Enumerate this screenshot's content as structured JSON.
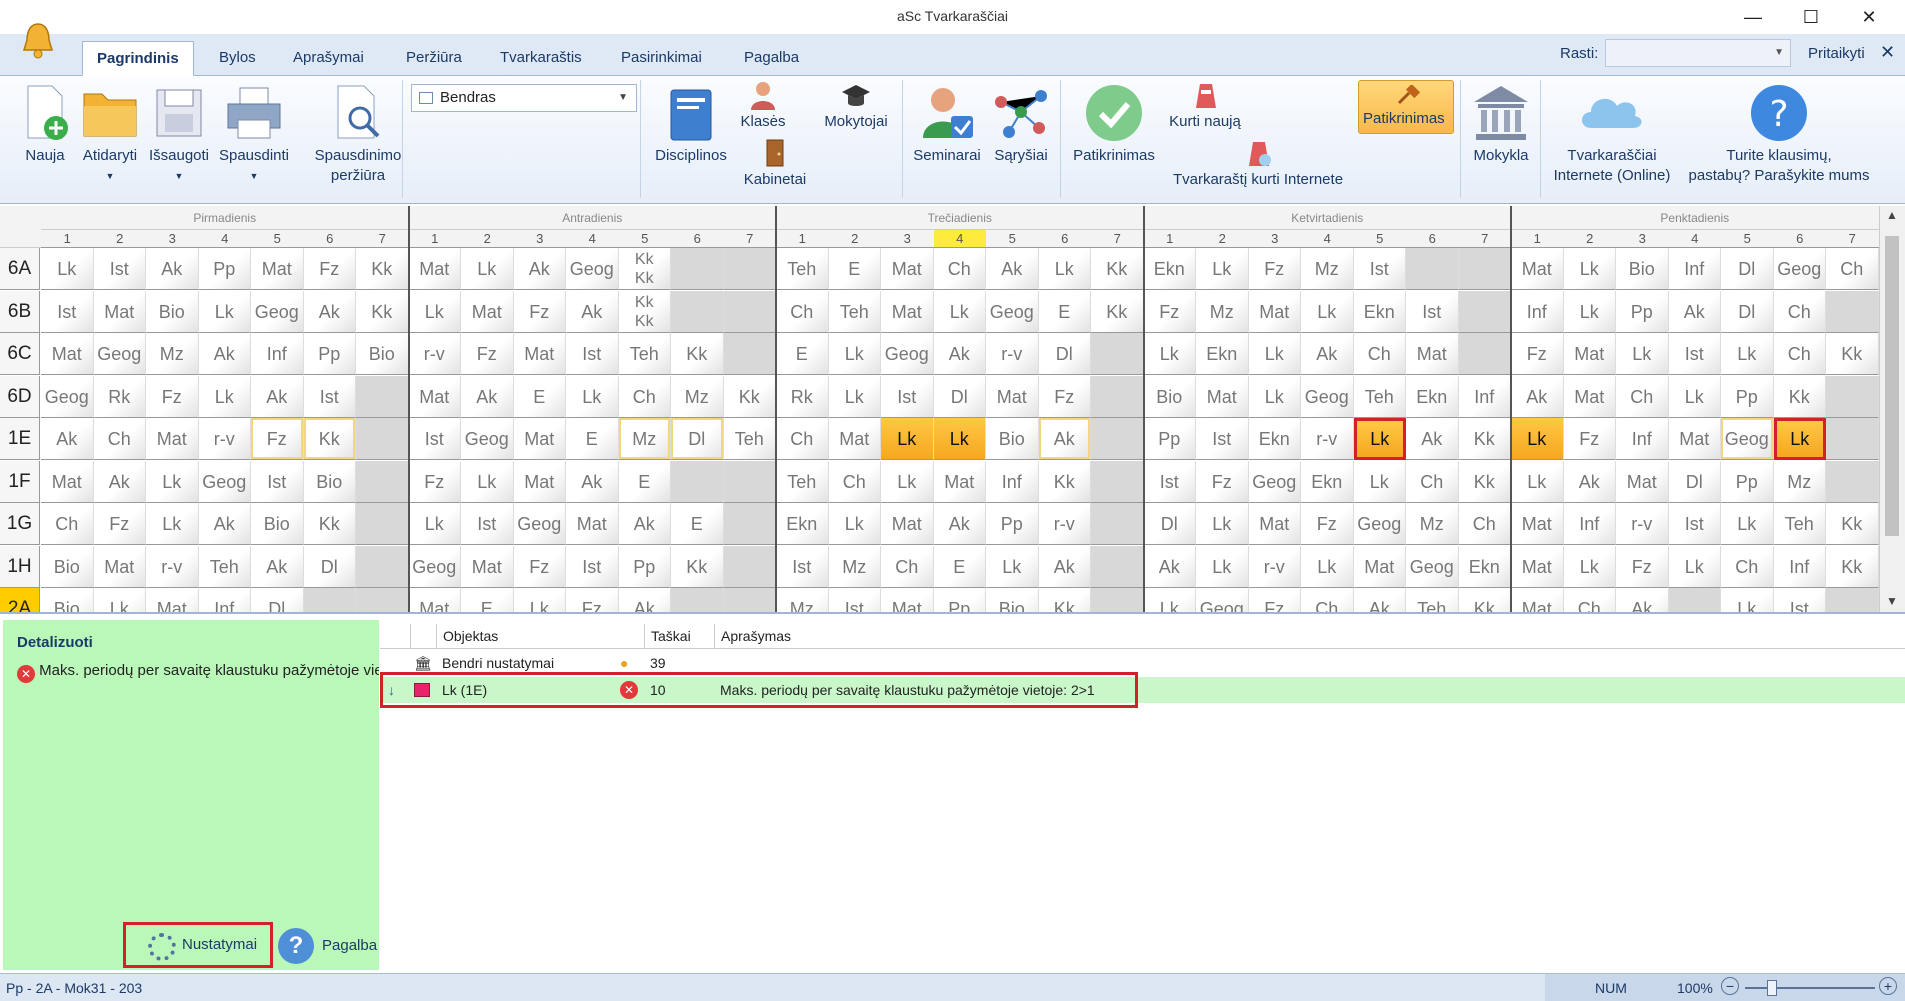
{
  "window": {
    "title": "aSc Tvarkaraščiai",
    "minimize": "—",
    "maximize": "☐",
    "close": "✕"
  },
  "tabs": [
    "Pagrindinis",
    "Bylos",
    "Aprašymai",
    "Peržiūra",
    "Tvarkaraštis",
    "Pasirinkimai",
    "Pagalba"
  ],
  "search": {
    "label": "Rasti:",
    "value": "",
    "right_label": "Pritaikyti",
    "close": "✕"
  },
  "ribbon": {
    "nauja": "Nauja",
    "atidaryti": "Atidaryti",
    "issaugoti": "Išsaugoti",
    "spausdinti": "Spausdinti",
    "spaudinimo_perziura_1": "Spausdinimo",
    "spaudinimo_perziura_2": "peržiūra",
    "view_combo": "Bendras",
    "disciplinos": "Disciplinos",
    "klases": "Klasės",
    "kabinetai": "Kabinetai",
    "mokytojai": "Mokytojai",
    "seminarai": "Seminarai",
    "sarysiai": "Sąryšiai",
    "patikrinimas_big": "Patikrinimas",
    "kurti_nauja": "Kurti naują",
    "kurti_internete": "Tvarkaraštį kurti Internete",
    "patikrinimas_active": "Patikrinimas",
    "mokykla": "Mokykla",
    "online_1": "Tvarkaraščiai",
    "online_2": "Internete (Online)",
    "klausimai_1": "Turite klausimų,",
    "klausimai_2": "pastabų? Parašykite mums"
  },
  "grid": {
    "days": [
      "Pirmadienis",
      "Antradienis",
      "Trečiadienis",
      "Ketvirtadienis",
      "Penktadienis"
    ],
    "periods": [
      "1",
      "2",
      "3",
      "4",
      "5",
      "6",
      "7"
    ],
    "highlighted_period": {
      "day": 2,
      "period": 4
    },
    "rows": [
      {
        "name": "6A",
        "cells": [
          [
            "Lk",
            "Ist",
            "Ak",
            "Pp",
            "Mat",
            "Fz",
            "Kk"
          ],
          [
            "Mat",
            "Lk",
            "Ak",
            "Geog",
            "Kk/Kk",
            "",
            ""
          ],
          [
            "Teh",
            "E",
            "Mat",
            "Ch",
            "Ak",
            "Lk",
            "Kk"
          ],
          [
            "Ekn",
            "Lk",
            "Fz",
            "Mz",
            "Ist",
            "",
            ""
          ],
          [
            "Mat",
            "Lk",
            "Bio",
            "Inf",
            "Dl",
            "Geog",
            "Ch"
          ]
        ]
      },
      {
        "name": "6B",
        "cells": [
          [
            "Ist",
            "Mat",
            "Bio",
            "Lk",
            "Geog",
            "Ak",
            "Kk"
          ],
          [
            "Lk",
            "Mat",
            "Fz",
            "Ak",
            "Kk/Kk",
            "",
            ""
          ],
          [
            "Ch",
            "Teh",
            "Mat",
            "Lk",
            "Geog",
            "E",
            "Kk"
          ],
          [
            "Fz",
            "Mz",
            "Mat",
            "Lk",
            "Ekn",
            "Ist",
            ""
          ],
          [
            "Inf",
            "Lk",
            "Pp",
            "Ak",
            "Dl",
            "Ch",
            ""
          ]
        ]
      },
      {
        "name": "6C",
        "cells": [
          [
            "Mat",
            "Geog",
            "Mz",
            "Ak",
            "Inf",
            "Pp",
            "Bio"
          ],
          [
            "r-v",
            "Fz",
            "Mat",
            "Ist",
            "Teh",
            "Kk",
            ""
          ],
          [
            "E",
            "Lk",
            "Geog",
            "Ak",
            "r-v",
            "Dl",
            ""
          ],
          [
            "Lk",
            "Ekn",
            "Lk",
            "Ak",
            "Ch",
            "Mat",
            ""
          ],
          [
            "Fz",
            "Mat",
            "Lk",
            "Ist",
            "Lk",
            "Ch",
            "Kk"
          ]
        ]
      },
      {
        "name": "6D",
        "cells": [
          [
            "Geog",
            "Rk",
            "Fz",
            "Lk",
            "Ak",
            "Ist",
            ""
          ],
          [
            "Mat",
            "Ak",
            "E",
            "Lk",
            "Ch",
            "Mz",
            "Kk"
          ],
          [
            "Rk",
            "Lk",
            "Ist",
            "Dl",
            "Mat",
            "Fz",
            ""
          ],
          [
            "Bio",
            "Mat",
            "Lk",
            "Geog",
            "Teh",
            "Ekn",
            "Inf"
          ],
          [
            "Ak",
            "Mat",
            "Ch",
            "Lk",
            "Pp",
            "Kk",
            ""
          ]
        ]
      },
      {
        "name": "1E",
        "cells": [
          [
            "Ak",
            "Ch",
            "Mat",
            "r-v",
            "Fz",
            "Kk",
            ""
          ],
          [
            "Ist",
            "Geog",
            "Mat",
            "E",
            "Mz",
            "Dl",
            "Teh"
          ],
          [
            "Ch",
            "Mat",
            "Lk",
            "Lk",
            "Bio",
            "Ak",
            ""
          ],
          [
            "Pp",
            "Ist",
            "Ekn",
            "r-v",
            "Lk",
            "Ak",
            "Kk"
          ],
          [
            "Lk",
            "Fz",
            "Inf",
            "Mat",
            "Geog",
            "Lk",
            ""
          ]
        ]
      },
      {
        "name": "1F",
        "cells": [
          [
            "Mat",
            "Ak",
            "Lk",
            "Geog",
            "Ist",
            "Bio",
            ""
          ],
          [
            "Fz",
            "Lk",
            "Mat",
            "Ak",
            "E",
            "",
            ""
          ],
          [
            "Teh",
            "Ch",
            "Lk",
            "Mat",
            "Inf",
            "Kk",
            ""
          ],
          [
            "Ist",
            "Fz",
            "Geog",
            "Ekn",
            "Lk",
            "Ch",
            "Kk"
          ],
          [
            "Lk",
            "Ak",
            "Mat",
            "Dl",
            "Pp",
            "Mz",
            ""
          ]
        ]
      },
      {
        "name": "1G",
        "cells": [
          [
            "Ch",
            "Fz",
            "Lk",
            "Ak",
            "Bio",
            "Kk",
            ""
          ],
          [
            "Lk",
            "Ist",
            "Geog",
            "Mat",
            "Ak",
            "E",
            ""
          ],
          [
            "Ekn",
            "Lk",
            "Mat",
            "Ak",
            "Pp",
            "r-v",
            ""
          ],
          [
            "Dl",
            "Lk",
            "Mat",
            "Fz",
            "Geog",
            "Mz",
            "Ch"
          ],
          [
            "Mat",
            "Inf",
            "r-v",
            "Ist",
            "Lk",
            "Teh",
            "Kk"
          ]
        ]
      },
      {
        "name": "1H",
        "cells": [
          [
            "Bio",
            "Mat",
            "r-v",
            "Teh",
            "Ak",
            "Dl",
            ""
          ],
          [
            "Geog",
            "Mat",
            "Fz",
            "Ist",
            "Pp",
            "Kk",
            ""
          ],
          [
            "Ist",
            "Mz",
            "Ch",
            "E",
            "Lk",
            "Ak",
            ""
          ],
          [
            "Ak",
            "Lk",
            "r-v",
            "Lk",
            "Mat",
            "Geog",
            "Ekn"
          ],
          [
            "Mat",
            "Lk",
            "Fz",
            "Lk",
            "Ch",
            "Inf",
            "Kk"
          ]
        ]
      },
      {
        "name": "2A",
        "cells": [
          [
            "Bio",
            "Lk",
            "Mat",
            "Inf",
            "Dl",
            "",
            ""
          ],
          [
            "Mat",
            "E",
            "Lk",
            "Fz",
            "Ak",
            "",
            ""
          ],
          [
            "Mz",
            "Ist",
            "Mat",
            "Pp",
            "Bio",
            "Kk",
            ""
          ],
          [
            "Lk",
            "Geog",
            "Fz",
            "Ch",
            "Ak",
            "Teh",
            "Kk"
          ],
          [
            "Mat",
            "Ch",
            "Ak",
            "",
            "Lk",
            "Ist",
            ""
          ]
        ]
      }
    ]
  },
  "details": {
    "header": "Detalizuoti",
    "message": "Maks. periodų per savaitę klaustuku pažymėtoje vietoje: 2>1",
    "settings_button": "Nustatymai",
    "help_button": "Pagalba"
  },
  "table": {
    "columns": [
      "Objektas",
      "Taškai",
      "Aprašymas"
    ],
    "rows": [
      {
        "object": "Bendri nustatymai",
        "points": "39",
        "description": ""
      },
      {
        "object": "Lk (1E)",
        "points": "10",
        "description": "Maks. periodų per savaitę klaustuku pažymėtoje vietoje: 2>1"
      }
    ]
  },
  "status": {
    "left": "Pp - 2A - Mok31 - 203",
    "num": "NUM",
    "zoom": "100%",
    "minus": "−",
    "plus": "+"
  },
  "colors": {
    "ribbon_bg": "#e6eef8",
    "highlight": "#f6a721",
    "error": "#d4202a",
    "pane_green": "#b9f8b9"
  }
}
